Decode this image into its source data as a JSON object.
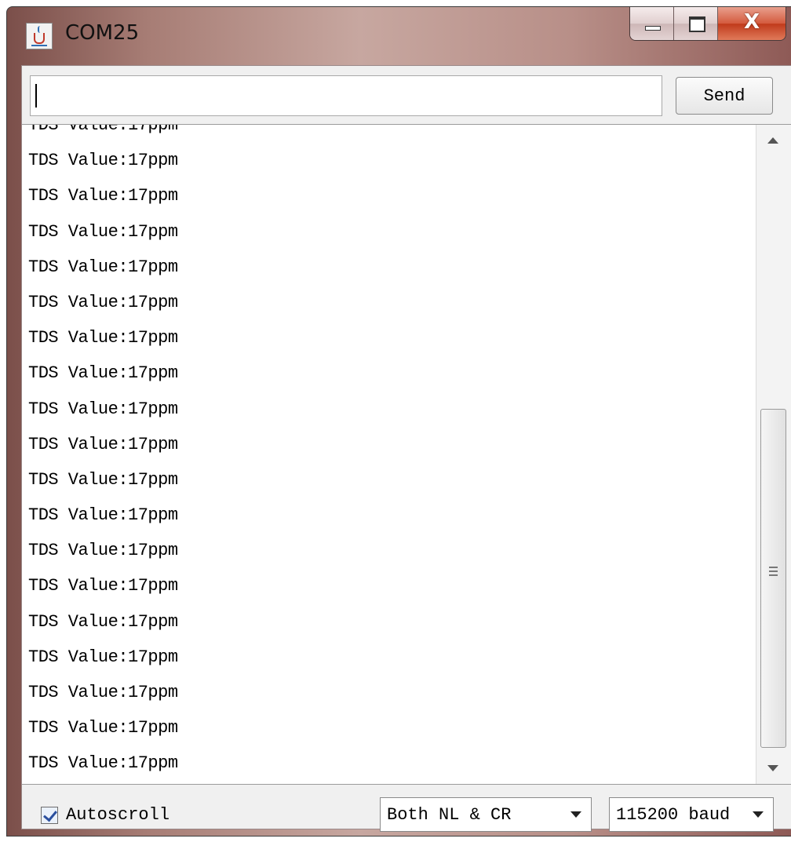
{
  "window": {
    "title": "COM25",
    "controls": [
      "minimize",
      "maximize",
      "close"
    ]
  },
  "send_bar": {
    "input_value": "",
    "send_label": "Send"
  },
  "output": {
    "lines": [
      "TDS Value:17ppm",
      "TDS Value:17ppm",
      "TDS Value:17ppm",
      "TDS Value:17ppm",
      "TDS Value:17ppm",
      "TDS Value:17ppm",
      "TDS Value:17ppm",
      "TDS Value:17ppm",
      "TDS Value:17ppm",
      "TDS Value:17ppm",
      "TDS Value:17ppm",
      "TDS Value:17ppm",
      "TDS Value:17ppm",
      "TDS Value:17ppm",
      "TDS Value:17ppm",
      "TDS Value:17ppm",
      "TDS Value:17ppm",
      "TDS Value:17ppm",
      "TDS Value:17ppm"
    ]
  },
  "footer": {
    "autoscroll_label": "Autoscroll",
    "autoscroll_checked": true,
    "line_ending": "Both NL & CR",
    "baud_rate": "115200 baud"
  },
  "icons": {
    "app": "java-cup-icon",
    "close": "X"
  }
}
